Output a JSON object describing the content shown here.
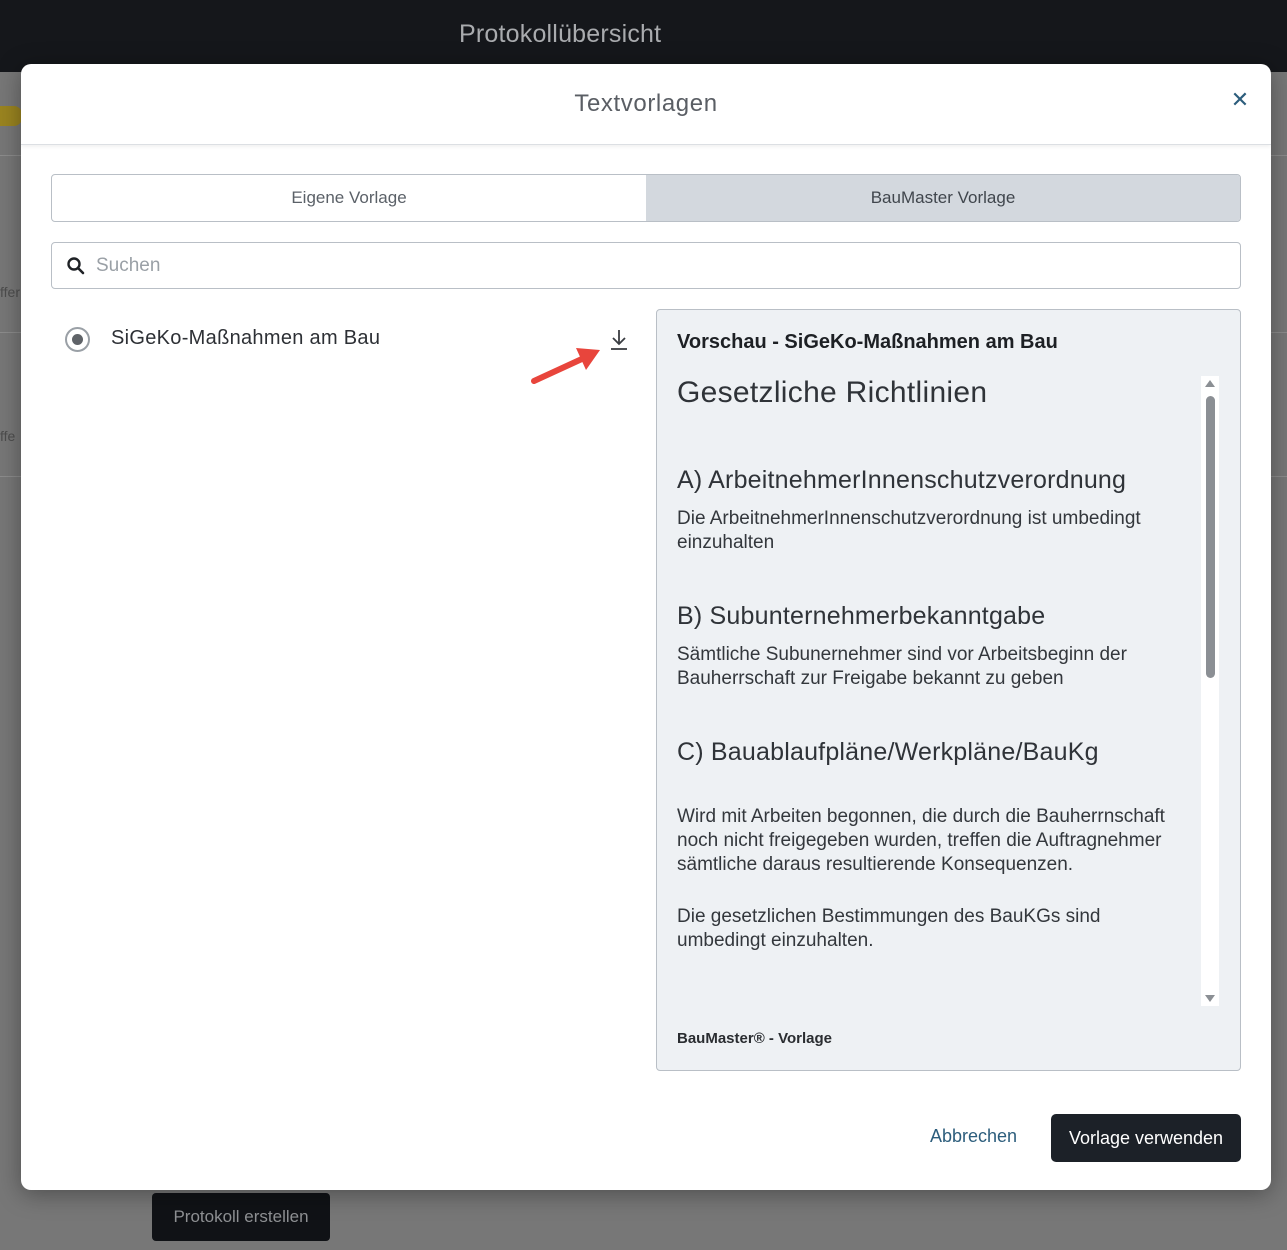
{
  "background": {
    "title": "Protokollübersicht",
    "side_text_1": "ffer",
    "side_text_2": "ffe",
    "create_button": "Protokoll erstellen"
  },
  "modal": {
    "title": "Textvorlagen",
    "close_icon": "close-icon",
    "tabs": [
      {
        "label": "Eigene Vorlage",
        "active": false
      },
      {
        "label": "BauMaster Vorlage",
        "active": true
      }
    ],
    "search": {
      "placeholder": "Suchen",
      "value": ""
    },
    "templates": [
      {
        "label": "SiGeKo-Maßnahmen am Bau",
        "selected": true
      }
    ],
    "preview": {
      "title": "Vorschau - SiGeKo-Maßnahmen am Bau",
      "heading": "Gesetzliche Richtlinien",
      "sections": [
        {
          "heading": "A) ArbeitnehmerInnenschutzverordnung",
          "text": "Die ArbeitnehmerInnenschutzverordnung ist umbedingt einzuhalten"
        },
        {
          "heading": "B) Subunternehmerbekanntgabe",
          "text": "Sämtliche Subunernehmer sind vor Arbeitsbeginn der Bauherrschaft zur Freigabe bekannt zu geben"
        },
        {
          "heading": "C) Bauablaufpläne/Werkpläne/BauKg",
          "text": "Wird mit Arbeiten begonnen, die durch die Bauherrnschaft noch nicht freigegeben wurden, treffen die Auftragnehmer sämtliche daraus resultierende Konsequenzen.",
          "text2": "Die gesetzlichen Bestimmungen des BauKGs sind umbedingt einzuhalten."
        }
      ],
      "footer": "BauMaster® - Vorlage"
    },
    "buttons": {
      "cancel": "Abbrechen",
      "use": "Vorlage verwenden"
    },
    "colors": {
      "accent": "#2c5d7c",
      "annotation_arrow": "#e8453c"
    }
  }
}
